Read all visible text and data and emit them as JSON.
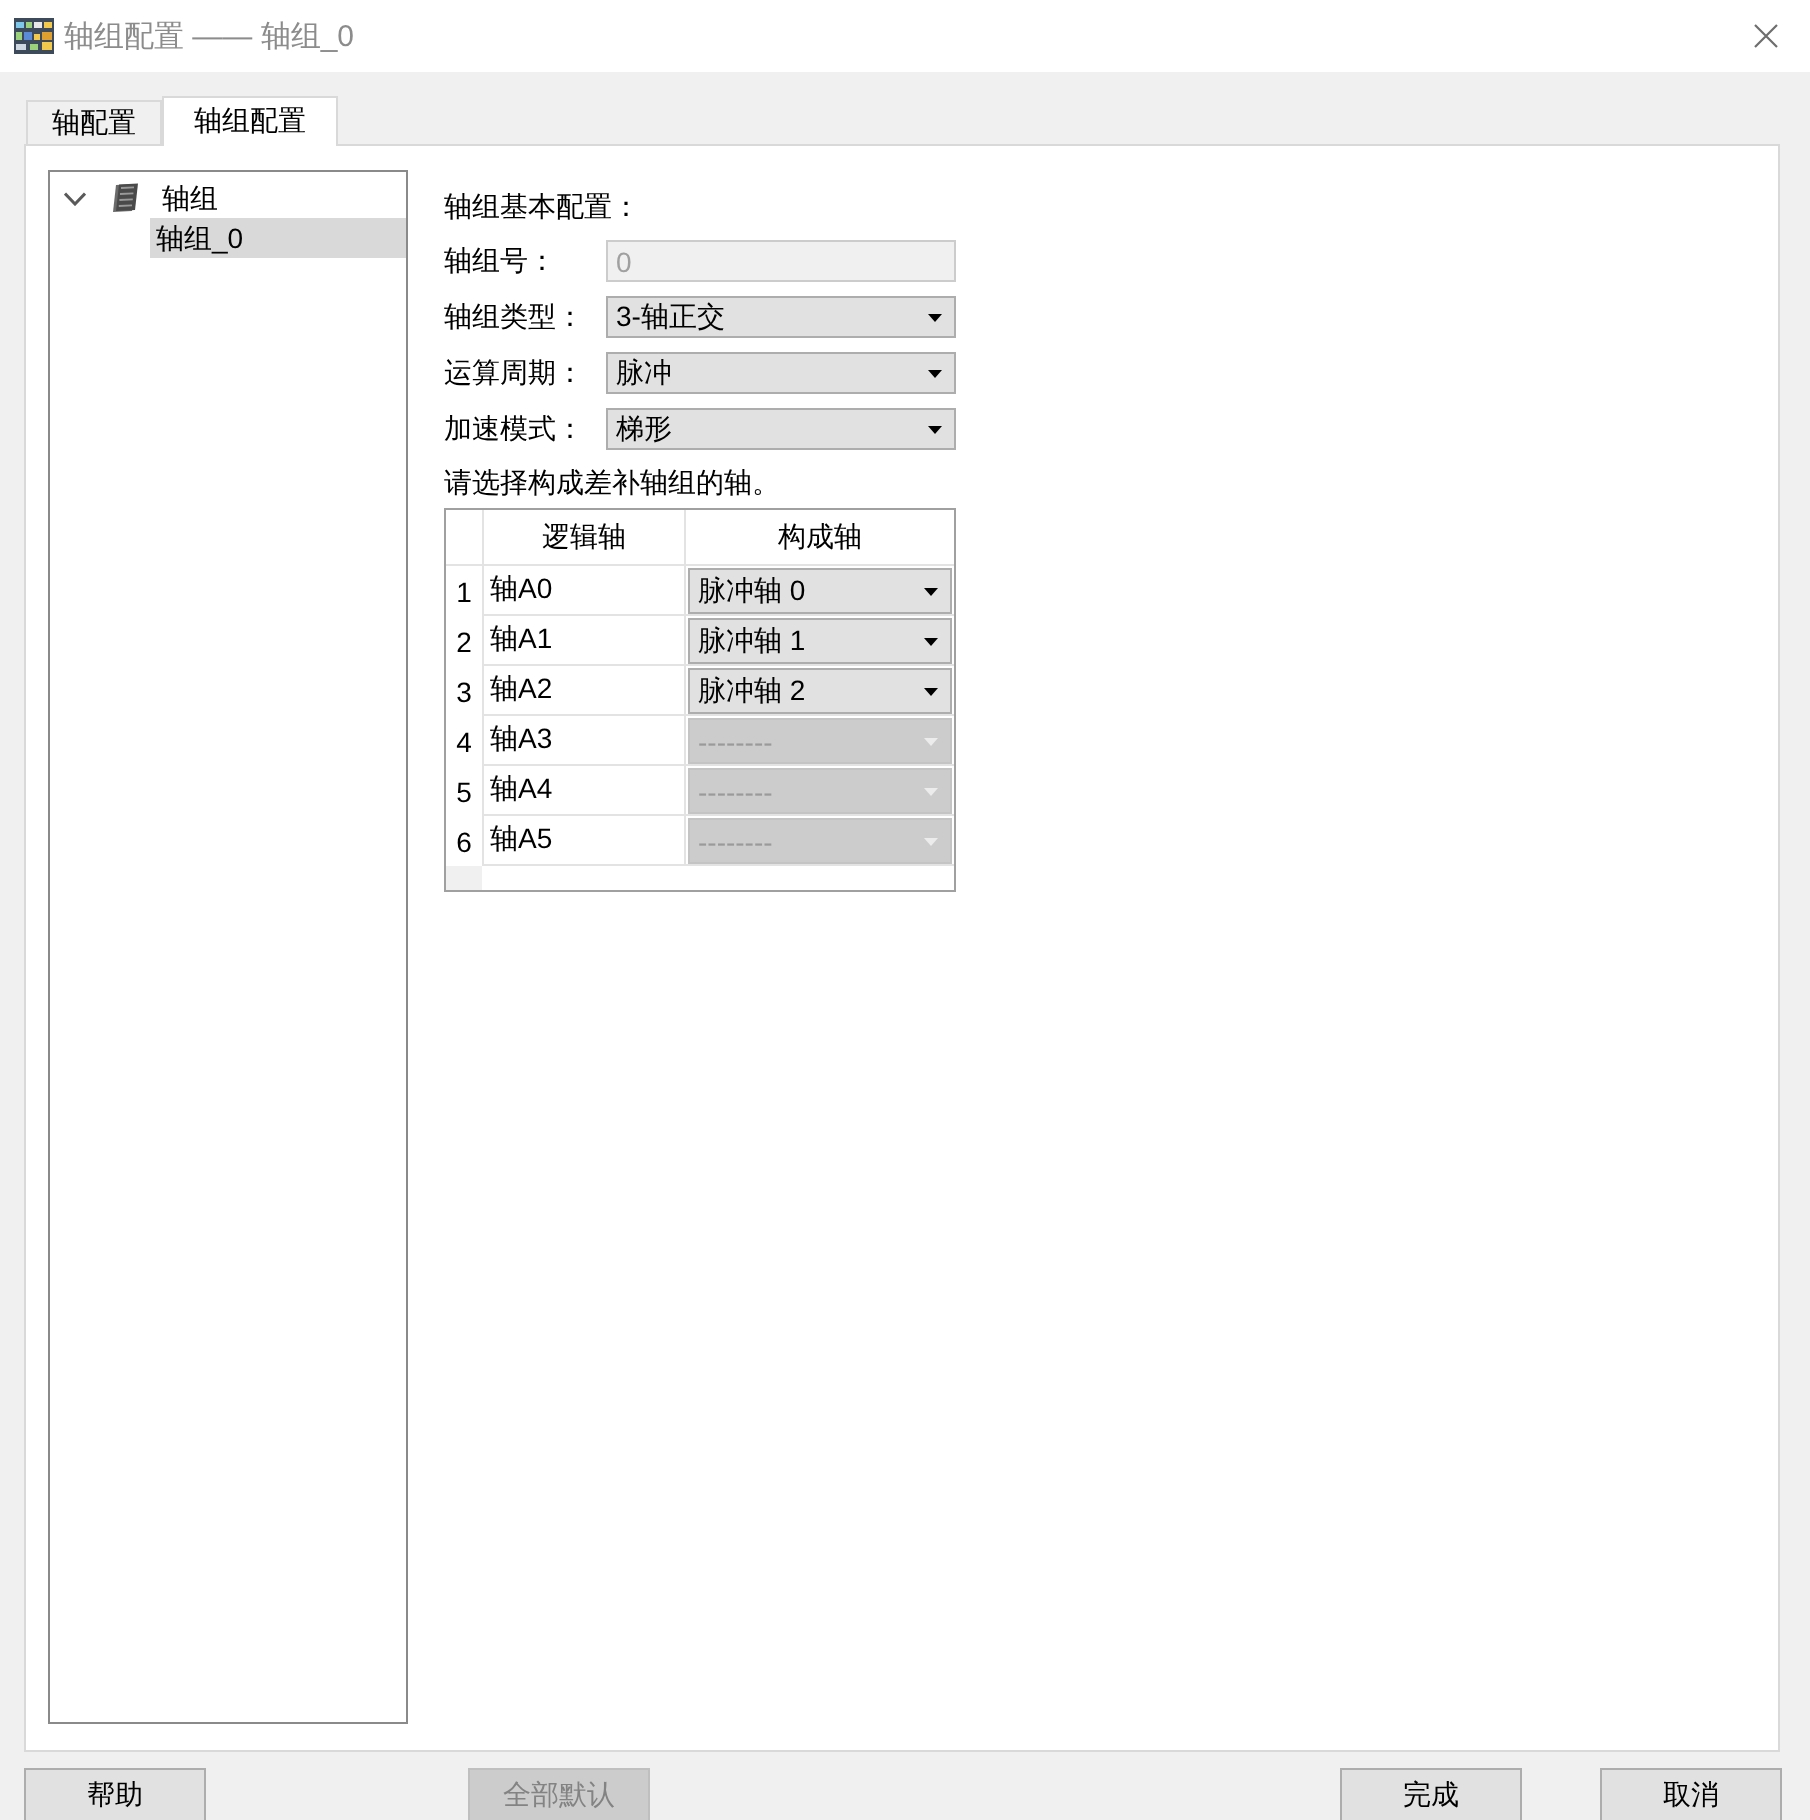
{
  "window": {
    "title": "轴组配置 —— 轴组_0"
  },
  "tabs": [
    {
      "label": "轴配置",
      "selected": false
    },
    {
      "label": "轴组配置",
      "selected": true
    }
  ],
  "tree": [
    {
      "label": "轴组",
      "expanded": true,
      "selected": false,
      "children": [
        {
          "label": "轴组_0",
          "selected": true
        }
      ]
    }
  ],
  "form": {
    "heading": "轴组基本配置：",
    "fields": [
      {
        "kind": "input",
        "label": "轴组号：",
        "value": "0",
        "disabled": true
      },
      {
        "kind": "dropdown",
        "label": "轴组类型：",
        "value": "3-轴正交",
        "disabled": false
      },
      {
        "kind": "dropdown",
        "label": "运算周期：",
        "value": "脉冲",
        "disabled": false
      },
      {
        "kind": "dropdown",
        "label": "加速模式：",
        "value": "梯形",
        "disabled": false
      }
    ],
    "instruction": "请选择构成差补轴组的轴。"
  },
  "axis_table": {
    "columns": [
      "逻辑轴",
      "构成轴"
    ],
    "rows": [
      {
        "index": "1",
        "logical": "轴A0",
        "component": "脉冲轴 0",
        "disabled": false
      },
      {
        "index": "2",
        "logical": "轴A1",
        "component": "脉冲轴 1",
        "disabled": false
      },
      {
        "index": "3",
        "logical": "轴A2",
        "component": "脉冲轴 2",
        "disabled": false
      },
      {
        "index": "4",
        "logical": "轴A3",
        "component": "--------",
        "disabled": true
      },
      {
        "index": "5",
        "logical": "轴A4",
        "component": "--------",
        "disabled": true
      },
      {
        "index": "6",
        "logical": "轴A5",
        "component": "--------",
        "disabled": true
      }
    ]
  },
  "buttons": [
    {
      "label": "帮助",
      "disabled": false
    },
    {
      "label": "全部默认",
      "disabled": true
    },
    {
      "label": "完成",
      "disabled": false
    },
    {
      "label": "取消",
      "disabled": false
    }
  ]
}
